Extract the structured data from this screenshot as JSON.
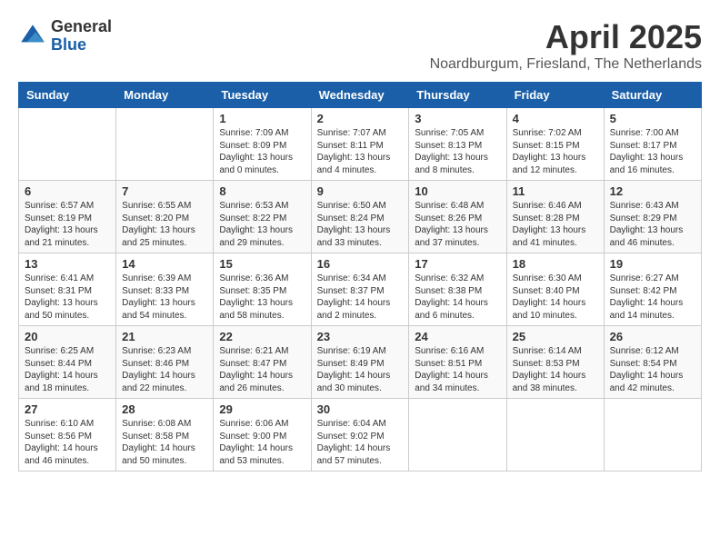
{
  "header": {
    "logo_general": "General",
    "logo_blue": "Blue",
    "month": "April 2025",
    "location": "Noardburgum, Friesland, The Netherlands"
  },
  "weekdays": [
    "Sunday",
    "Monday",
    "Tuesday",
    "Wednesday",
    "Thursday",
    "Friday",
    "Saturday"
  ],
  "weeks": [
    [
      {
        "day": "",
        "content": ""
      },
      {
        "day": "",
        "content": ""
      },
      {
        "day": "1",
        "content": "Sunrise: 7:09 AM\nSunset: 8:09 PM\nDaylight: 13 hours and 0 minutes."
      },
      {
        "day": "2",
        "content": "Sunrise: 7:07 AM\nSunset: 8:11 PM\nDaylight: 13 hours and 4 minutes."
      },
      {
        "day": "3",
        "content": "Sunrise: 7:05 AM\nSunset: 8:13 PM\nDaylight: 13 hours and 8 minutes."
      },
      {
        "day": "4",
        "content": "Sunrise: 7:02 AM\nSunset: 8:15 PM\nDaylight: 13 hours and 12 minutes."
      },
      {
        "day": "5",
        "content": "Sunrise: 7:00 AM\nSunset: 8:17 PM\nDaylight: 13 hours and 16 minutes."
      }
    ],
    [
      {
        "day": "6",
        "content": "Sunrise: 6:57 AM\nSunset: 8:19 PM\nDaylight: 13 hours and 21 minutes."
      },
      {
        "day": "7",
        "content": "Sunrise: 6:55 AM\nSunset: 8:20 PM\nDaylight: 13 hours and 25 minutes."
      },
      {
        "day": "8",
        "content": "Sunrise: 6:53 AM\nSunset: 8:22 PM\nDaylight: 13 hours and 29 minutes."
      },
      {
        "day": "9",
        "content": "Sunrise: 6:50 AM\nSunset: 8:24 PM\nDaylight: 13 hours and 33 minutes."
      },
      {
        "day": "10",
        "content": "Sunrise: 6:48 AM\nSunset: 8:26 PM\nDaylight: 13 hours and 37 minutes."
      },
      {
        "day": "11",
        "content": "Sunrise: 6:46 AM\nSunset: 8:28 PM\nDaylight: 13 hours and 41 minutes."
      },
      {
        "day": "12",
        "content": "Sunrise: 6:43 AM\nSunset: 8:29 PM\nDaylight: 13 hours and 46 minutes."
      }
    ],
    [
      {
        "day": "13",
        "content": "Sunrise: 6:41 AM\nSunset: 8:31 PM\nDaylight: 13 hours and 50 minutes."
      },
      {
        "day": "14",
        "content": "Sunrise: 6:39 AM\nSunset: 8:33 PM\nDaylight: 13 hours and 54 minutes."
      },
      {
        "day": "15",
        "content": "Sunrise: 6:36 AM\nSunset: 8:35 PM\nDaylight: 13 hours and 58 minutes."
      },
      {
        "day": "16",
        "content": "Sunrise: 6:34 AM\nSunset: 8:37 PM\nDaylight: 14 hours and 2 minutes."
      },
      {
        "day": "17",
        "content": "Sunrise: 6:32 AM\nSunset: 8:38 PM\nDaylight: 14 hours and 6 minutes."
      },
      {
        "day": "18",
        "content": "Sunrise: 6:30 AM\nSunset: 8:40 PM\nDaylight: 14 hours and 10 minutes."
      },
      {
        "day": "19",
        "content": "Sunrise: 6:27 AM\nSunset: 8:42 PM\nDaylight: 14 hours and 14 minutes."
      }
    ],
    [
      {
        "day": "20",
        "content": "Sunrise: 6:25 AM\nSunset: 8:44 PM\nDaylight: 14 hours and 18 minutes."
      },
      {
        "day": "21",
        "content": "Sunrise: 6:23 AM\nSunset: 8:46 PM\nDaylight: 14 hours and 22 minutes."
      },
      {
        "day": "22",
        "content": "Sunrise: 6:21 AM\nSunset: 8:47 PM\nDaylight: 14 hours and 26 minutes."
      },
      {
        "day": "23",
        "content": "Sunrise: 6:19 AM\nSunset: 8:49 PM\nDaylight: 14 hours and 30 minutes."
      },
      {
        "day": "24",
        "content": "Sunrise: 6:16 AM\nSunset: 8:51 PM\nDaylight: 14 hours and 34 minutes."
      },
      {
        "day": "25",
        "content": "Sunrise: 6:14 AM\nSunset: 8:53 PM\nDaylight: 14 hours and 38 minutes."
      },
      {
        "day": "26",
        "content": "Sunrise: 6:12 AM\nSunset: 8:54 PM\nDaylight: 14 hours and 42 minutes."
      }
    ],
    [
      {
        "day": "27",
        "content": "Sunrise: 6:10 AM\nSunset: 8:56 PM\nDaylight: 14 hours and 46 minutes."
      },
      {
        "day": "28",
        "content": "Sunrise: 6:08 AM\nSunset: 8:58 PM\nDaylight: 14 hours and 50 minutes."
      },
      {
        "day": "29",
        "content": "Sunrise: 6:06 AM\nSunset: 9:00 PM\nDaylight: 14 hours and 53 minutes."
      },
      {
        "day": "30",
        "content": "Sunrise: 6:04 AM\nSunset: 9:02 PM\nDaylight: 14 hours and 57 minutes."
      },
      {
        "day": "",
        "content": ""
      },
      {
        "day": "",
        "content": ""
      },
      {
        "day": "",
        "content": ""
      }
    ]
  ]
}
